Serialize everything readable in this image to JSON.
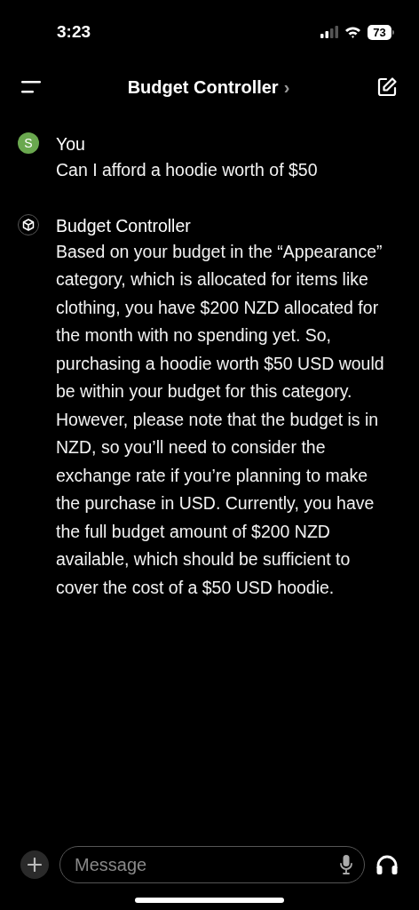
{
  "status_bar": {
    "time": "3:23",
    "battery": "73"
  },
  "header": {
    "title": "Budget Controller",
    "chevron": "›"
  },
  "messages": [
    {
      "kind": "user",
      "avatar": "S",
      "sender": "You",
      "text": "Can I afford a hoodie worth of $50"
    },
    {
      "kind": "assistant",
      "sender": "Budget Controller",
      "text": "Based on your budget in the “Appearance” category, which is allocated for items like clothing, you have $200 NZD allocated for the month with no spending yet. So, purchasing a hoodie worth $50 USD would be within your budget for this category. However, please note that the budget is in NZD, so you’ll need to consider the exchange rate if you’re planning to make the purchase in USD. Currently, you have the full budget amount of $200 NZD available, which should be sufficient to cover the cost of a $50 USD hoodie."
    }
  ],
  "composer": {
    "placeholder": "Message"
  }
}
